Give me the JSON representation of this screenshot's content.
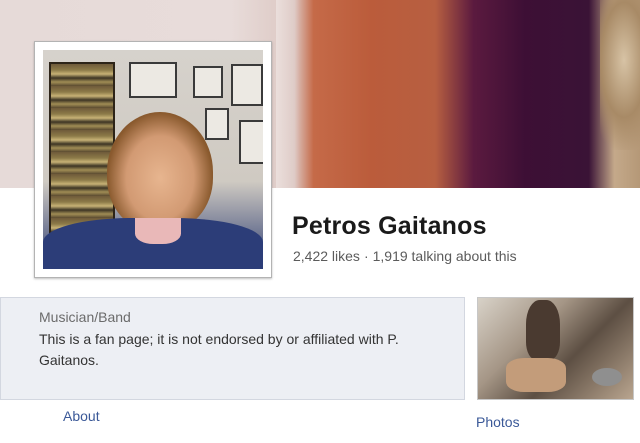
{
  "page": {
    "name": "Petros Gaitanos",
    "likes": "2,422 likes",
    "separator": "·",
    "talking": "1,919 talking about this"
  },
  "about": {
    "category": "Musician/Band",
    "description": "This is a fan page; it is not endorsed by or affiliated with P. Gaitanos."
  },
  "tabs": {
    "about": "About",
    "photos": "Photos"
  },
  "colors": {
    "link": "#3b5998",
    "about_bg": "#edeff4"
  }
}
